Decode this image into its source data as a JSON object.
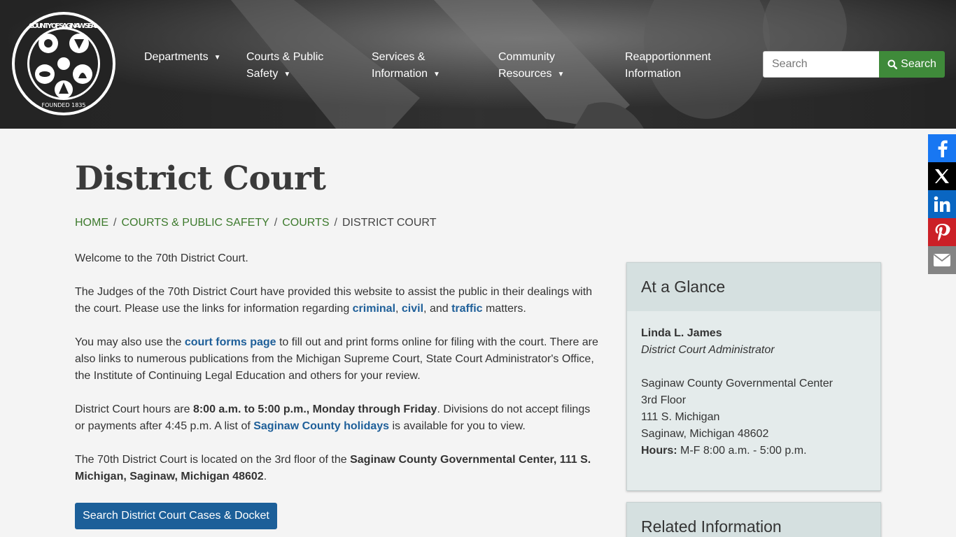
{
  "header": {
    "seal": {
      "top_text": "COUNTY OF SAGINAW SEAL",
      "bottom_text": "FOUNDED 1835"
    },
    "nav": [
      {
        "line1": "Departments",
        "line2": "",
        "caret": true
      },
      {
        "line1": "Courts & Public",
        "line2": "Safety",
        "caret": true
      },
      {
        "line1": "Services &",
        "line2": "Information",
        "caret": true
      },
      {
        "line1": "Community",
        "line2": "Resources",
        "caret": true
      },
      {
        "line1": "Reapportionment",
        "line2": "Information",
        "caret": false
      }
    ],
    "search": {
      "placeholder": "Search",
      "button_label": "Search"
    }
  },
  "share": {
    "icons": [
      "facebook-icon",
      "x-icon",
      "linkedin-icon",
      "pinterest-icon",
      "email-icon"
    ]
  },
  "page": {
    "title": "District Court",
    "breadcrumb": [
      {
        "label": "HOME",
        "link": true
      },
      {
        "label": "COURTS & PUBLIC SAFETY",
        "link": true
      },
      {
        "label": "COURTS",
        "link": true
      },
      {
        "label": "DISTRICT COURT",
        "link": false
      }
    ]
  },
  "content": {
    "p1": "Welcome to the 70th District Court.",
    "p2": {
      "t1": "The Judges of the 70th District Court have provided this website to assist the public in their dealings with the court. Please use the links for information regarding ",
      "l1": "criminal",
      "t2": ", ",
      "l2": "civil",
      "t3": ", and ",
      "l3": "traffic",
      "t4": " matters."
    },
    "p3": {
      "t1": "You may also use the ",
      "l1": "court forms page",
      "t2": " to fill out and print forms online for filing with the court. There are also links to numerous publications from the Michigan Supreme Court, State Court Administrator's Office, the Institute of Continuing Legal Education and others for your review."
    },
    "p4": {
      "t1": "District Court hours are ",
      "b1": "8:00 a.m. to 5:00 p.m., Monday through Friday",
      "t2": ". Divisions do not accept filings or payments after 4:45 p.m. A list of ",
      "l1": "Saginaw County holidays",
      "t3": " is available for you to view."
    },
    "p5": {
      "t1": "The 70th District Court is located on the 3rd floor of the ",
      "b1": "Saginaw County Governmental Center, 111 S. Michigan, Saginaw, Michigan 48602",
      "t2": "."
    },
    "cta": "Search District Court Cases & Docket"
  },
  "sidebar": {
    "glance": {
      "title": "At a Glance",
      "name": "Linda L. James",
      "role": "District Court Administrator",
      "addr1": "Saginaw County Governmental Center",
      "addr2": "3rd Floor",
      "addr3": "111 S. Michigan",
      "addr4": "Saginaw, Michigan 48602",
      "hours_label": "Hours:",
      "hours": " M-F 8:00 a.m. - 5:00 p.m."
    },
    "related": {
      "title": "Related Information"
    }
  },
  "colors": {
    "header_bg": "#232323",
    "breadcrumb_link": "#3d7a2d",
    "link": "#1e5f99",
    "cta_bg": "#1c5f99",
    "search_button": "#3f8a3a",
    "facebook": "#1877f2",
    "x": "#000000",
    "linkedin": "#0a66c2",
    "pinterest": "#cb2027",
    "email": "#848484"
  }
}
